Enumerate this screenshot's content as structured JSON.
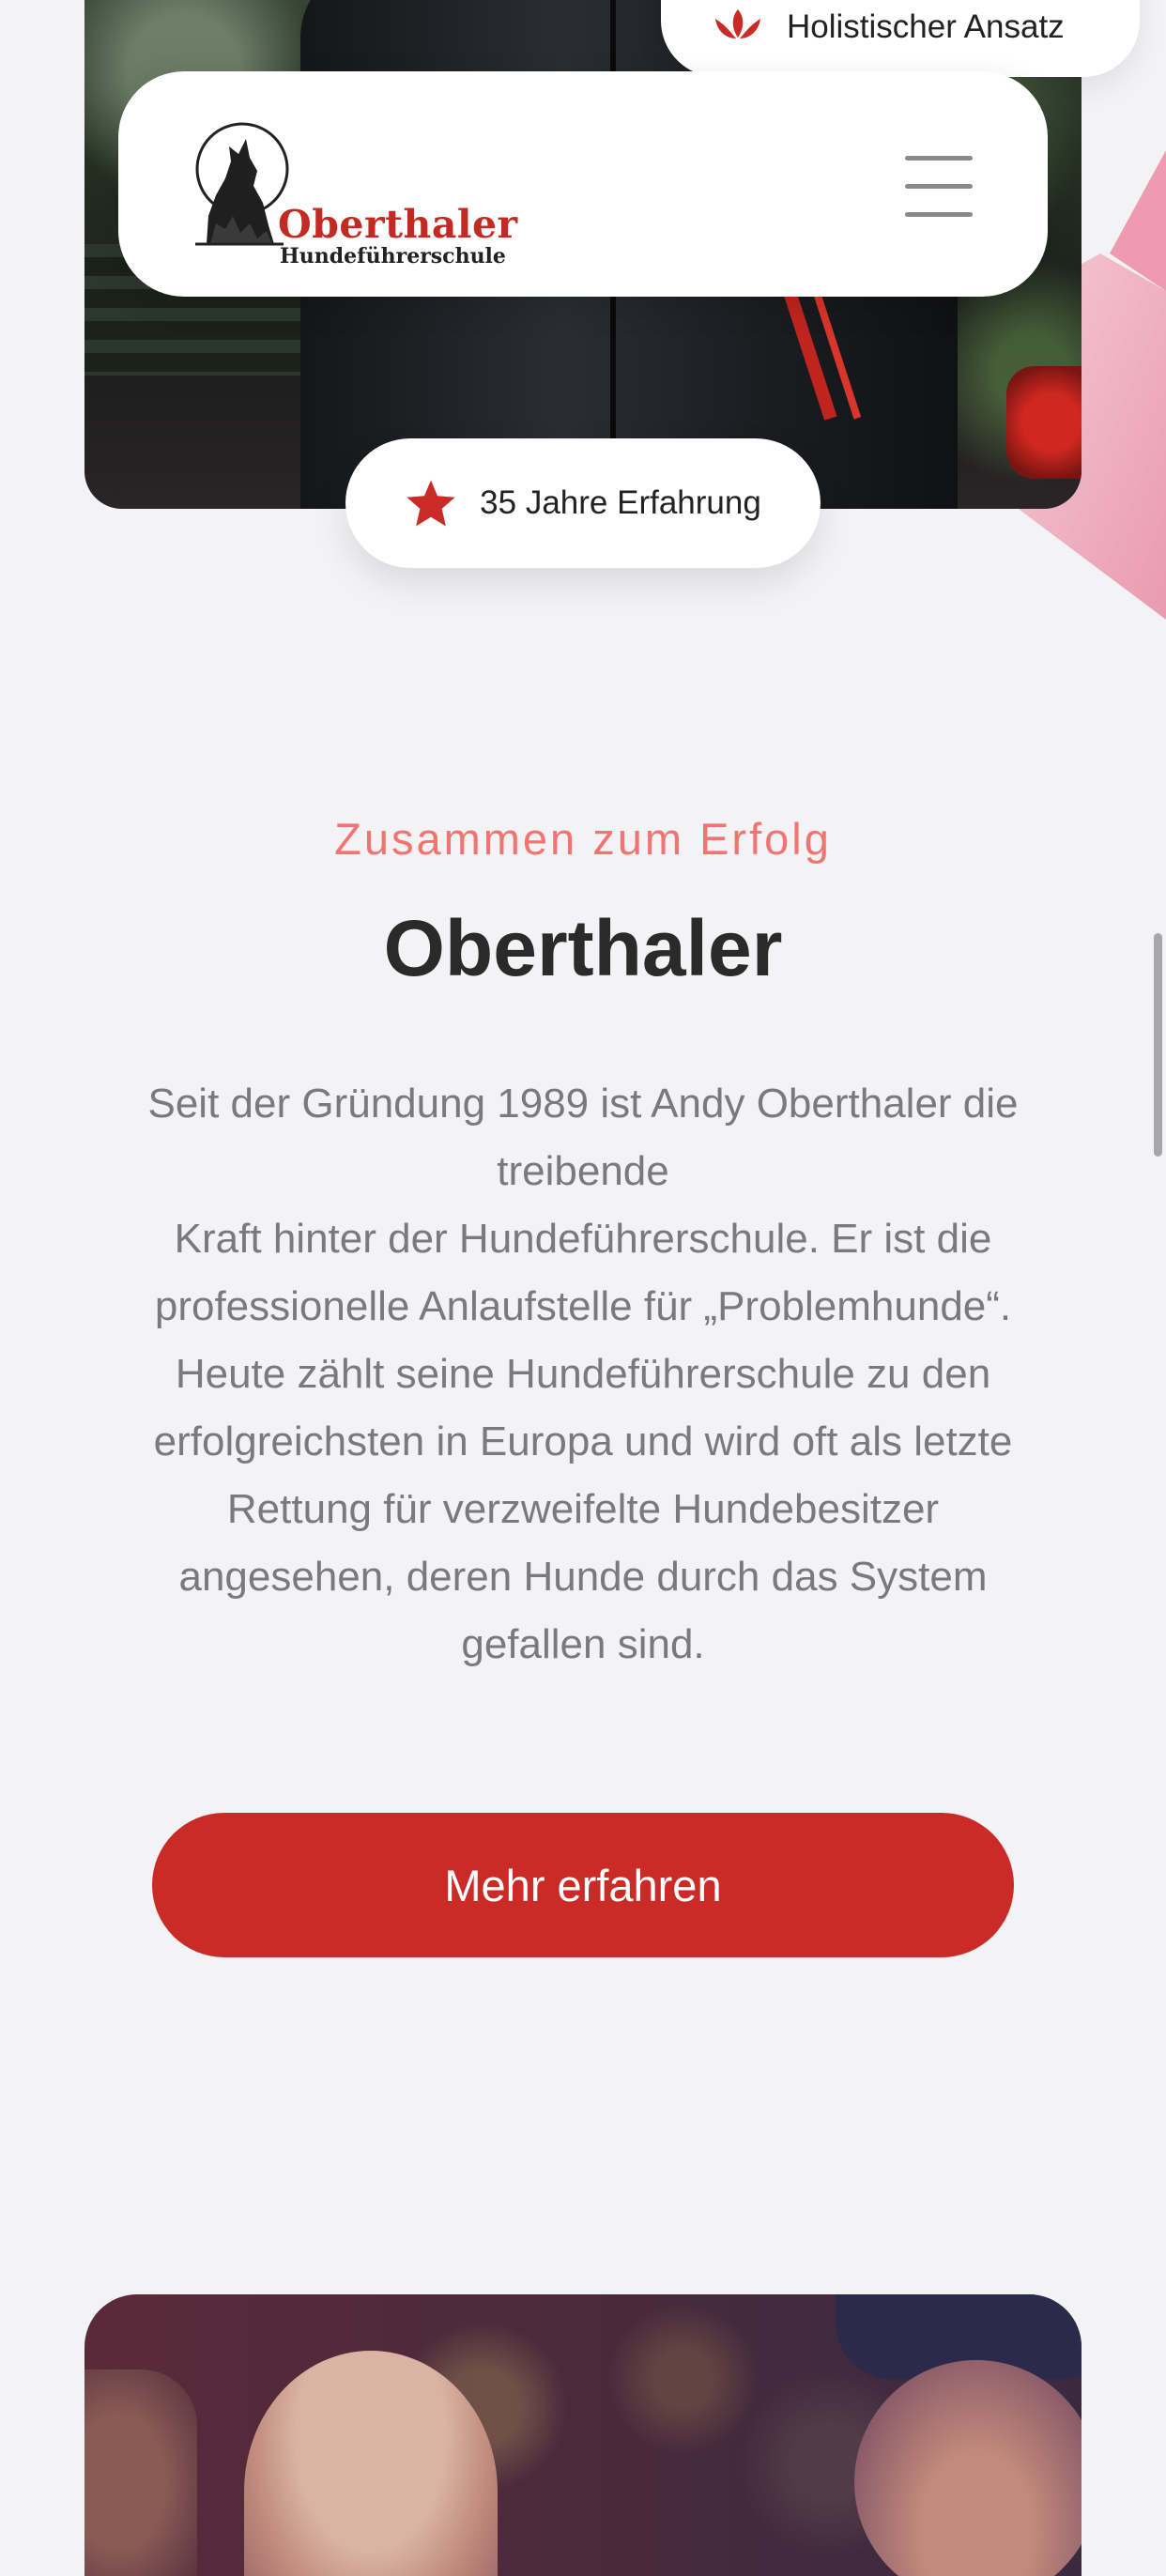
{
  "colors": {
    "accent": "#cb2b27",
    "eyebrow": "#f0746f",
    "background": "#f3f3f6",
    "pink_deco": "#ee9fb6"
  },
  "badges": {
    "holistic": {
      "icon": "lotus-icon",
      "label": "Holistischer Ansatz"
    },
    "experience": {
      "icon": "star-icon",
      "label": "35 Jahre Erfahrung"
    }
  },
  "header": {
    "logo_title": "Oberthaler",
    "logo_subtitle": "Hundeführerschule",
    "menu_icon": "hamburger-menu-icon"
  },
  "intro": {
    "eyebrow": "Zusammen zum Erfolg",
    "headline": "Oberthaler",
    "body_lines": [
      "Seit der Gründung 1989 ist Andy Oberthaler die",
      "treibende",
      "Kraft hinter der Hundeführerschule. Er ist die",
      "professionelle Anlaufstelle für „Problemhunde“.",
      "Heute zählt seine Hundeführerschule zu den",
      "erfolgreichsten in Europa und wird oft als letzte",
      "Rettung für verzweifelte Hundebesitzer",
      "angesehen, deren Hunde durch das System",
      "gefallen sind."
    ],
    "cta_label": "Mehr erfahren"
  }
}
